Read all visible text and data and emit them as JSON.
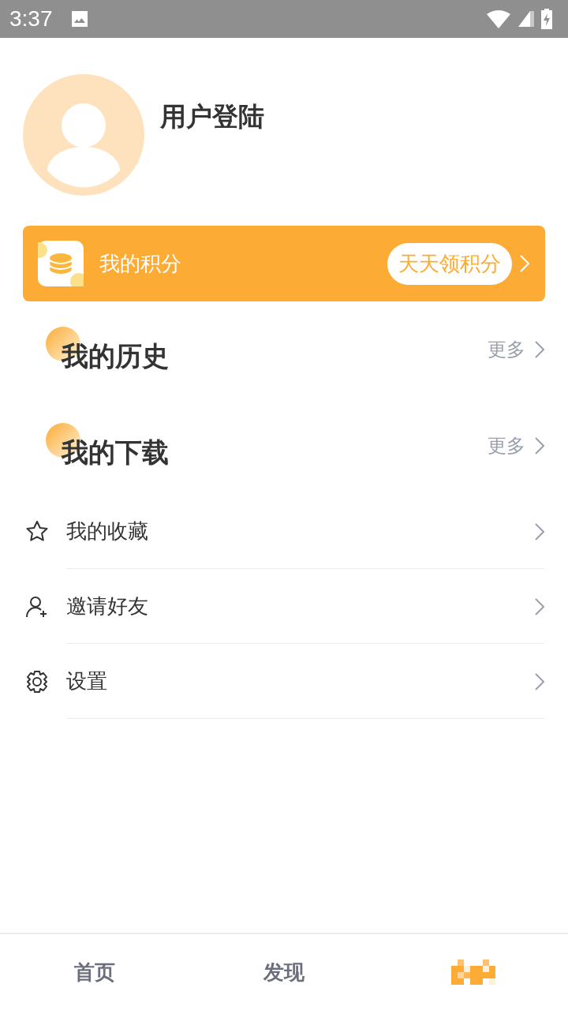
{
  "status_bar": {
    "time": "3:37"
  },
  "profile": {
    "title": "用户登陆"
  },
  "points_card": {
    "label": "我的积分",
    "action": "天天领积分"
  },
  "sections": [
    {
      "title": "我的历史",
      "more": "更多"
    },
    {
      "title": "我的下载",
      "more": "更多"
    }
  ],
  "menu": [
    {
      "kind": "star",
      "label": "我的收藏"
    },
    {
      "kind": "invite",
      "label": "邀请好友"
    },
    {
      "kind": "settings",
      "label": "设置"
    }
  ],
  "tabs": [
    {
      "kind": "text",
      "label": "首页",
      "selected": false
    },
    {
      "kind": "text",
      "label": "发现",
      "selected": false
    },
    {
      "kind": "pixel",
      "selected": true
    }
  ]
}
